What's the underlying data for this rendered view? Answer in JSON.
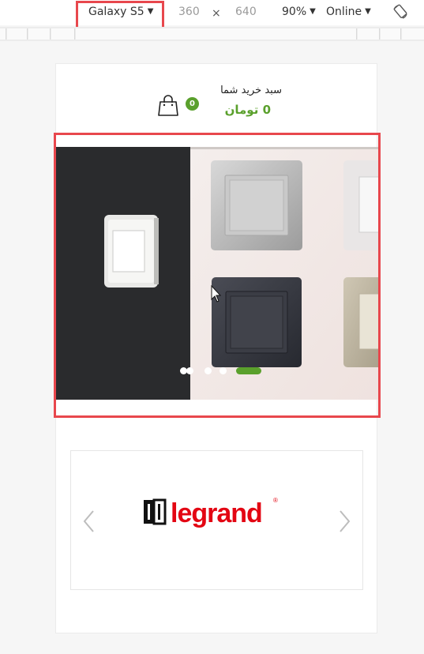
{
  "devtools": {
    "device_name": "Galaxy S5",
    "width": "360",
    "times": "×",
    "height": "640",
    "zoom": "90%",
    "network": "Online"
  },
  "cart": {
    "title": "سبد خرید شما",
    "total": "0 تومان",
    "count": "0"
  },
  "slider": {
    "slide_count": 5,
    "active_index": 4
  },
  "brands": {
    "logo_text": "legrand",
    "logo_mark": "®",
    "brand_color": "#e30613"
  },
  "colors": {
    "accent_green": "#5aa02c",
    "highlight_red": "#e8474d"
  }
}
